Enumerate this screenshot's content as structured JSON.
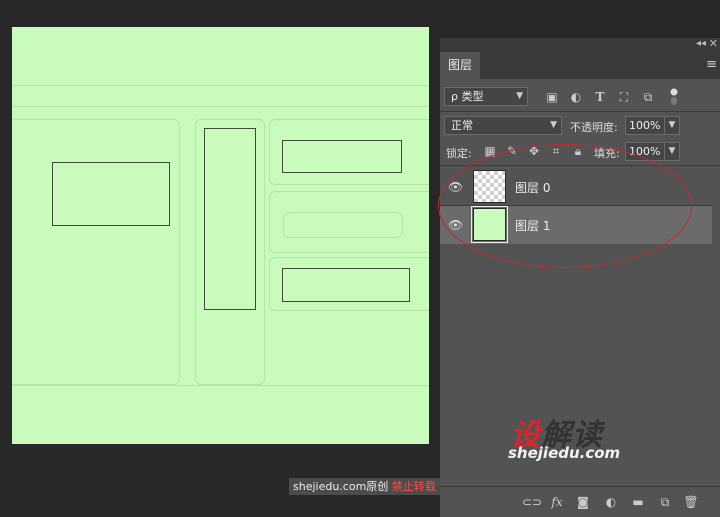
{
  "panel": {
    "tab_label": "图层",
    "collapse_glyph": "◂◂",
    "close_glyph": "✕",
    "menu_glyph": "≡",
    "filter": {
      "search_glyph": "ρ",
      "value": "类型"
    },
    "filter_icons": [
      "image-filter-icon",
      "adjustment-filter-icon",
      "type-filter-icon",
      "shape-filter-icon",
      "smart-object-filter-icon",
      "filter-toggle-icon"
    ],
    "blend_mode": "正常",
    "opacity_label": "不透明度:",
    "opacity_value": "100%",
    "lock_label": "锁定:",
    "fill_label": "填充:",
    "fill_value": "100%",
    "layers": [
      {
        "name": "图层 0",
        "thumbnail": "transparent",
        "visible": true,
        "selected": false
      },
      {
        "name": "图层 1",
        "thumbnail": "#c9fcbc",
        "visible": true,
        "selected": true
      }
    ],
    "bottom_icons": [
      "link-layers-icon",
      "layer-style-fx-icon",
      "add-mask-icon",
      "adjustment-layer-icon",
      "new-group-icon",
      "new-layer-icon",
      "delete-layer-icon"
    ]
  },
  "canvas": {
    "fill_color": "#c9fcbc"
  },
  "watermark": {
    "logo_part1": "设",
    "logo_part2": "解读",
    "url": "shejiedu.com"
  },
  "credit": {
    "site": "shejiedu.com",
    "original": "原创",
    "notice": "禁止转载"
  },
  "colors": {
    "annotation": "#c8282e",
    "background": "#282828",
    "panel": "#535353"
  }
}
